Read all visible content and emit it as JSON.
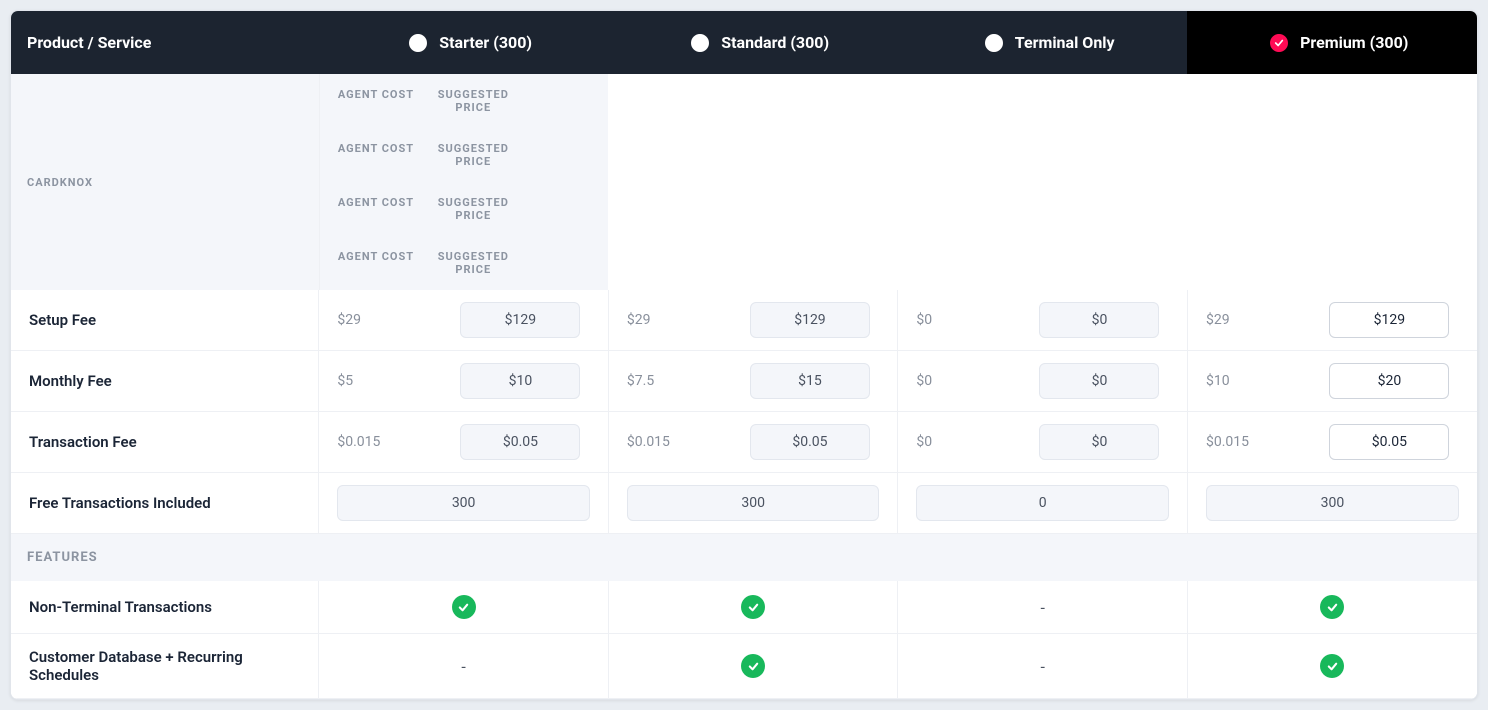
{
  "header": {
    "product_label": "Product / Service",
    "plans": [
      {
        "id": "starter",
        "label": "Starter (300)",
        "selected": false
      },
      {
        "id": "standard",
        "label": "Standard (300)",
        "selected": false
      },
      {
        "id": "terminal",
        "label": "Terminal Only",
        "selected": false
      },
      {
        "id": "premium",
        "label": "Premium (300)",
        "selected": true
      }
    ]
  },
  "sections": {
    "cardknox": "Cardknox",
    "features": "Features"
  },
  "sublabels": {
    "agent_cost": "Agent Cost",
    "suggested_price": "Suggested Price"
  },
  "rows": {
    "setup_fee": {
      "label": "Setup Fee",
      "plans": [
        {
          "agent": "$29",
          "price": "$129"
        },
        {
          "agent": "$29",
          "price": "$129"
        },
        {
          "agent": "$0",
          "price": "$0"
        },
        {
          "agent": "$29",
          "price": "$129"
        }
      ]
    },
    "monthly_fee": {
      "label": "Monthly Fee",
      "plans": [
        {
          "agent": "$5",
          "price": "$10"
        },
        {
          "agent": "$7.5",
          "price": "$15"
        },
        {
          "agent": "$0",
          "price": "$0"
        },
        {
          "agent": "$10",
          "price": "$20"
        }
      ]
    },
    "transaction_fee": {
      "label": "Transaction Fee",
      "plans": [
        {
          "agent": "$0.015",
          "price": "$0.05"
        },
        {
          "agent": "$0.015",
          "price": "$0.05"
        },
        {
          "agent": "$0",
          "price": "$0"
        },
        {
          "agent": "$0.015",
          "price": "$0.05"
        }
      ]
    },
    "free_transactions": {
      "label": "Free Transactions Included",
      "plans": [
        "300",
        "300",
        "0",
        "300"
      ]
    }
  },
  "features": [
    {
      "label": "Non-Terminal Transactions",
      "plans": [
        true,
        true,
        false,
        true
      ]
    },
    {
      "label": "Customer Database + Recurring Schedules",
      "plans": [
        false,
        true,
        false,
        true
      ]
    }
  ]
}
